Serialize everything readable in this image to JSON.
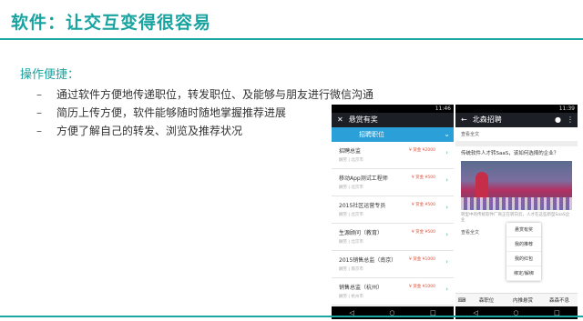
{
  "slide": {
    "title": "软件：让交互变得很容易",
    "section_label": "操作便捷：",
    "bullets": [
      "通过软件方便地传递职位，转发职位、及能够与朋友进行微信沟通",
      "简历上传方便，软件能够随时随地掌握推荐进展",
      "方便了解自己的转发、浏览及推荐状况"
    ]
  },
  "phone1": {
    "status_time": "11:46",
    "app_title": "悬赏有奖",
    "filter_label": "招聘职位",
    "jobs": [
      {
        "title": "招聘总监",
        "meta": "酬劳 | 北京市",
        "reward": "¥ 赏金 ¥2000"
      },
      {
        "title": "移动App测试工程师",
        "meta": "酬劳 | 北京市",
        "reward": "¥ 赏金 ¥500"
      },
      {
        "title": "2015社区运营专员",
        "meta": "酬劳 | 北京市",
        "reward": "¥ 赏金 ¥500"
      },
      {
        "title": "生源顾问（教育）",
        "meta": "酬劳 | 北京市",
        "reward": "¥ 赏金 ¥500"
      },
      {
        "title": "2015销售总监（南京）",
        "meta": "酬劳 | 南京市",
        "reward": "¥ 赏金 ¥1000"
      },
      {
        "title": "销售总监（杭州）",
        "meta": "酬劳 | 杭州市",
        "reward": "¥ 赏金 ¥1000"
      }
    ]
  },
  "phone2": {
    "status_time": "11:39",
    "app_title": "北森招聘",
    "read_all": "查看全文",
    "article_title": "传统软件人才转SaaS，该如何选择的企业？",
    "article_text": "转型中的传统软件厂商正在转向云，人才在这些新型SaaS企业",
    "popup_items": [
      "悬赏有奖",
      "我的推荐",
      "我的红包",
      "绑定/解绑"
    ],
    "tabs": [
      "森职位",
      "内推悬赏",
      "森森不息"
    ]
  },
  "colors": {
    "accent": "#1aa7a4",
    "app_bar": "#1c1f26",
    "filter_bar": "#2a9fd8",
    "reward": "#e0513a"
  }
}
